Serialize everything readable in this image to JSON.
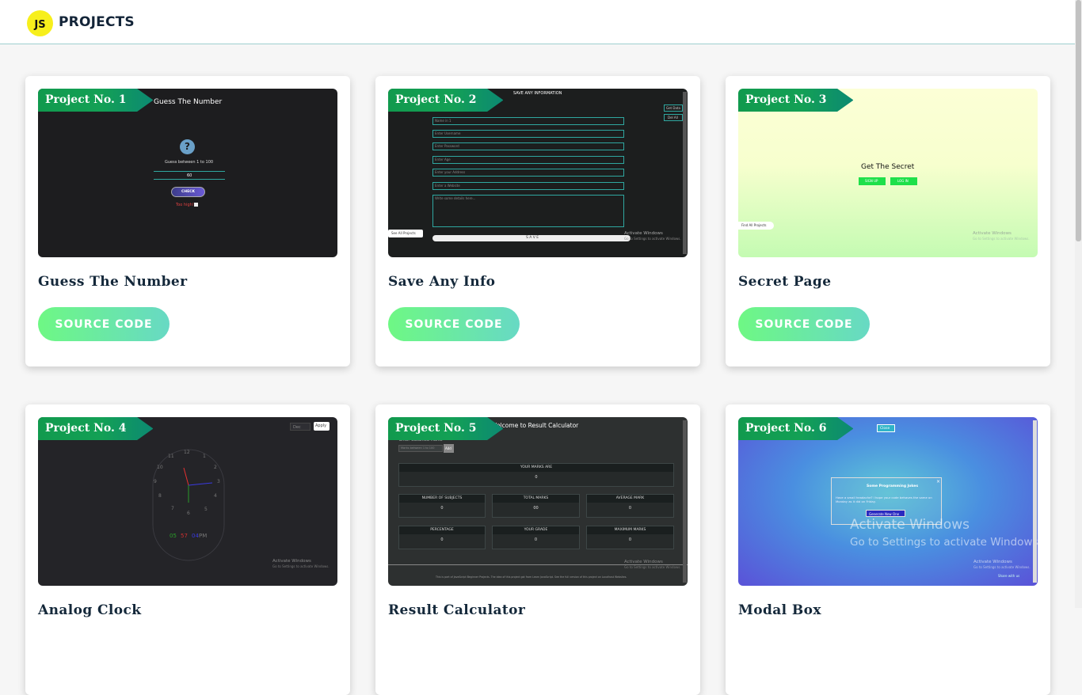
{
  "header": {
    "logo_badge": "JS",
    "logo_text": "PROJECTS"
  },
  "source_label": "SOURCE CODE",
  "cards": [
    {
      "ribbon": "Project No. 1",
      "title": "Guess The Number",
      "preview": {
        "heading": "Guess The Number",
        "icon": "?",
        "prompt": "Guess between 1 to 100",
        "input": "60",
        "button": "CHECK",
        "feedback": "Too high!"
      }
    },
    {
      "ribbon": "Project No. 2",
      "title": "Save Any Info",
      "preview": {
        "heading": "SAVE ANY INFORMATION",
        "fields": [
          "Name in 1",
          "Enter Username",
          "Enter Password",
          "Enter Age",
          "Enter your Address",
          "Enter a Website"
        ],
        "textarea": "Write some details here...",
        "side_buttons": [
          "Get Data",
          "Del All"
        ],
        "see_all": "See All Projects",
        "save": "S A V E",
        "watermark1": "Activate Windows",
        "watermark2": "Go to Settings to activate Windows."
      }
    },
    {
      "ribbon": "Project No. 3",
      "title": "Secret Page",
      "preview": {
        "heading": "Get The Secret",
        "btn1": "SIGN UP",
        "btn2": "LOG IN",
        "find_all": "Find All Projects",
        "watermark1": "Activate Windows",
        "watermark2": "Go to Settings to activate Windows."
      }
    },
    {
      "ribbon": "Project No. 4",
      "title": "Analog Clock",
      "preview": {
        "select": "Dec",
        "apply": "Apply",
        "numbers": [
          "12",
          "1",
          "2",
          "3",
          "4",
          "5",
          "6",
          "7",
          "8",
          "9",
          "10",
          "11"
        ],
        "digital_h": "05",
        "digital_m": "57",
        "digital_s": "04",
        "ampm": "PM",
        "watermark1": "Activate Windows",
        "watermark2": "Go to Settings to activate Windows."
      }
    },
    {
      "ribbon": "Project No. 5",
      "title": "Result Calculator",
      "preview": {
        "heading": "Welcome to Result Calculator",
        "sub": "Enter Obtained Marks",
        "input_ph": "Marks between 1 to 100",
        "add": "Add",
        "your_marks": "YOUR MARKS ARE",
        "your_marks_val": "0",
        "stats": [
          {
            "label": "NUMBER OF SUBJECTS",
            "value": "0"
          },
          {
            "label": "TOTAL MARKS",
            "value": "00"
          },
          {
            "label": "AVERAGE MARK",
            "value": "0"
          },
          {
            "label": "PERCENTAGE",
            "value": "0"
          },
          {
            "label": "YOUR GRADE",
            "value": "0"
          },
          {
            "label": "MAXIMUM MARKS",
            "value": "0"
          }
        ],
        "footer": "This is part of JavaScript Beginner Projects. The idea of this project got from Learn JavaScript. See the full version of this project on Localhost Websites.",
        "watermark1": "Activate Windows",
        "watermark2": "Go to Settings to activate Windows."
      }
    },
    {
      "ribbon": "Project No. 6",
      "title": "Modal Box",
      "preview": {
        "close": "Close",
        "modal_title": "Some Programming Jokes",
        "modal_text": "Have a small headache? I hope your code behaves the same on Monday as it did on Friday.",
        "modal_btn": "Generate New One",
        "watermark1": "Activate Windows",
        "watermark2": "Go to Settings to activate Windows",
        "small_wm1": "Activate Windows",
        "small_wm2": "Go to Settings to activate Windows.",
        "corner": "Share with us"
      }
    }
  ],
  "colors": {
    "accent_green": "#6ef884",
    "accent_teal": "#67d9c4",
    "ribbon": "#13a055",
    "logo": "#f7ef1c"
  }
}
